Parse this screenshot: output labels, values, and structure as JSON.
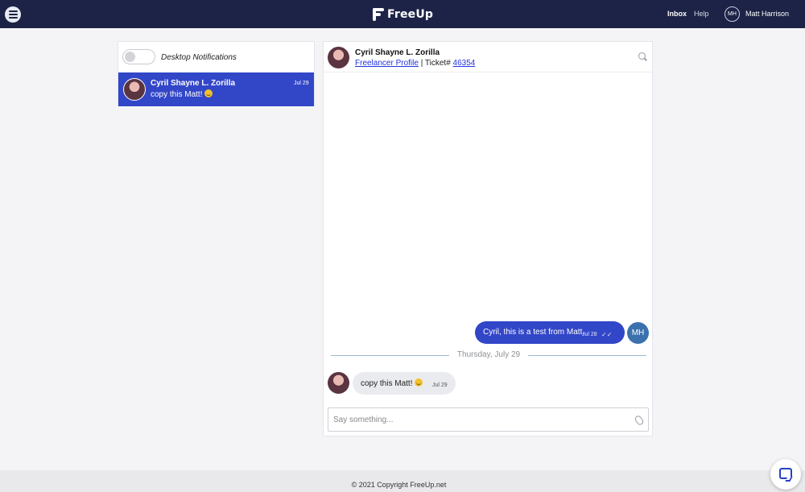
{
  "nav": {
    "logo": "FreeUp",
    "inbox": "Inbox",
    "help": "Help",
    "user_initials": "MH",
    "user_name": "Matt Harrison"
  },
  "sidebar": {
    "notifications_label": "Desktop Notifications",
    "conversations": [
      {
        "name": "Cyril Shayne L. Zorilla",
        "preview": "copy this Matt!",
        "date": "Jul 29"
      }
    ]
  },
  "chat": {
    "contact_name": "Cyril Shayne L. Zorilla",
    "profile_link": "Freelancer Profile",
    "ticket_label": "| Ticket#",
    "ticket_number": "46354",
    "messages": [
      {
        "text": "Cyril, this is a test from Matt.",
        "time": "Jul 28"
      },
      {
        "text": "copy this Matt!",
        "time": "Jul 29"
      }
    ],
    "day_divider": "Thursday, July 29",
    "me_initials": "MH",
    "compose_placeholder": "Say something..."
  },
  "footer": {
    "copyright": "© 2021 Copyright FreeUp.net"
  },
  "colors": {
    "nav_bg": "#1c2346",
    "accent": "#3246c8",
    "link": "#2233dd"
  }
}
